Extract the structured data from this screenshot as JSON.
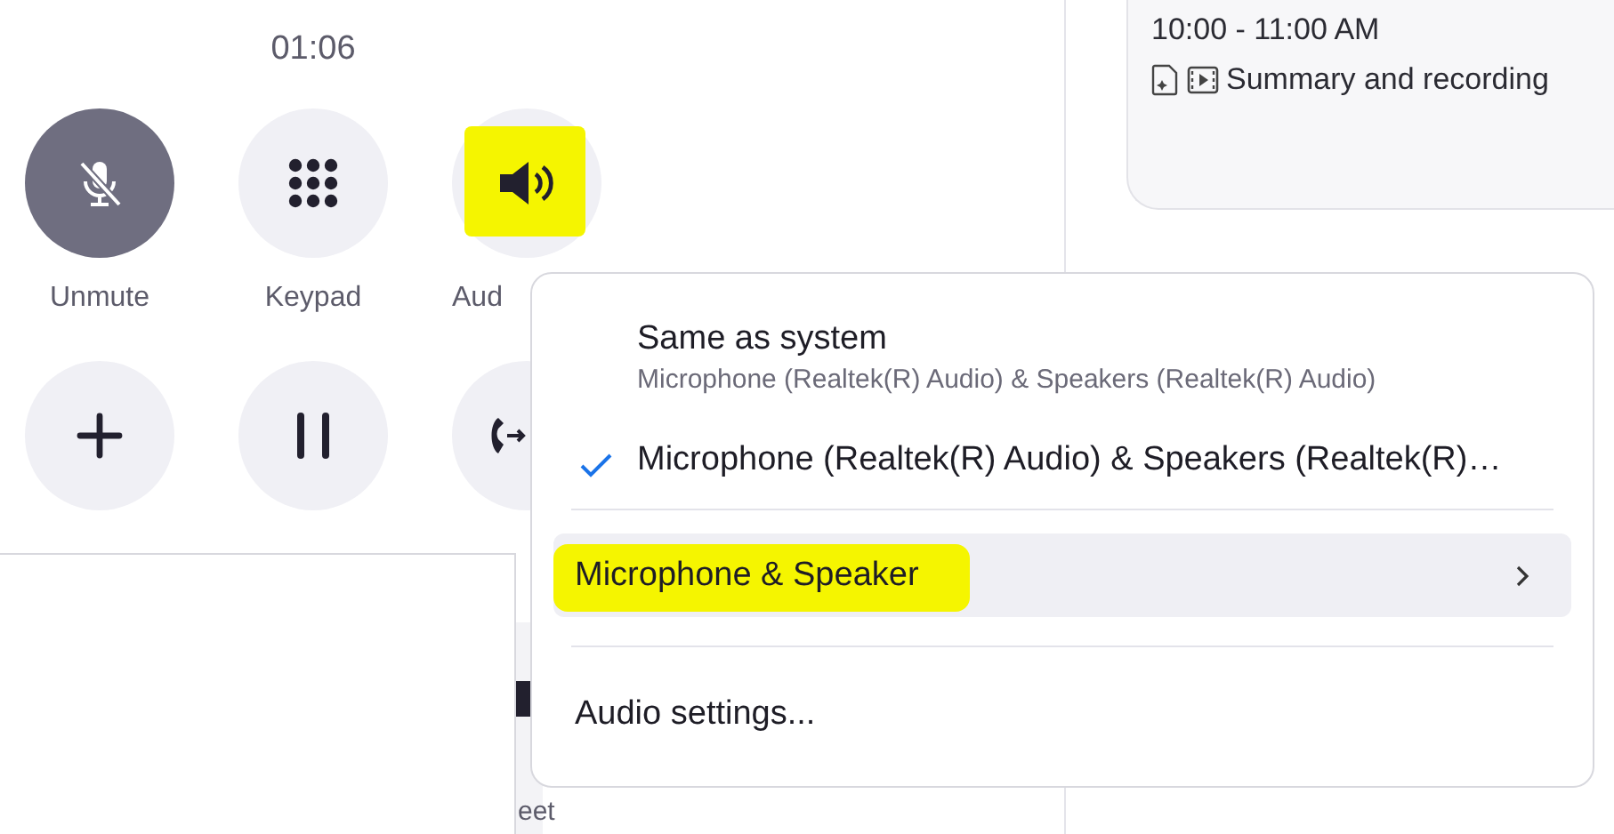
{
  "call": {
    "timer": "01:06",
    "controls": [
      {
        "label": "Unmute",
        "kind": "mic-off",
        "active": true,
        "highlighted": false
      },
      {
        "label": "Keypad",
        "kind": "keypad",
        "active": false,
        "highlighted": false
      },
      {
        "label": "Aud",
        "kind": "speaker",
        "active": false,
        "highlighted": true
      }
    ],
    "controls_row_2": [
      {
        "kind": "plus"
      },
      {
        "kind": "pause"
      },
      {
        "kind": "transfer"
      }
    ]
  },
  "meeting_card": {
    "time": "10:00 - 11:00 AM",
    "summary": "Summary and recording"
  },
  "background_text": "eet",
  "audio_menu": {
    "items": [
      {
        "kind": "option",
        "label": "Same as system",
        "detail": "Microphone (Realtek(R) Audio) & Speakers (Realtek(R) Audio)",
        "checked": false
      },
      {
        "kind": "option",
        "label": "Microphone (Realtek(R) Audio) & Speakers (Realtek(R)…",
        "checked": true
      },
      {
        "kind": "submenu",
        "label": "Microphone & Speaker",
        "selected": true,
        "highlighted": true
      },
      {
        "kind": "action",
        "label": "Audio settings..."
      }
    ]
  }
}
